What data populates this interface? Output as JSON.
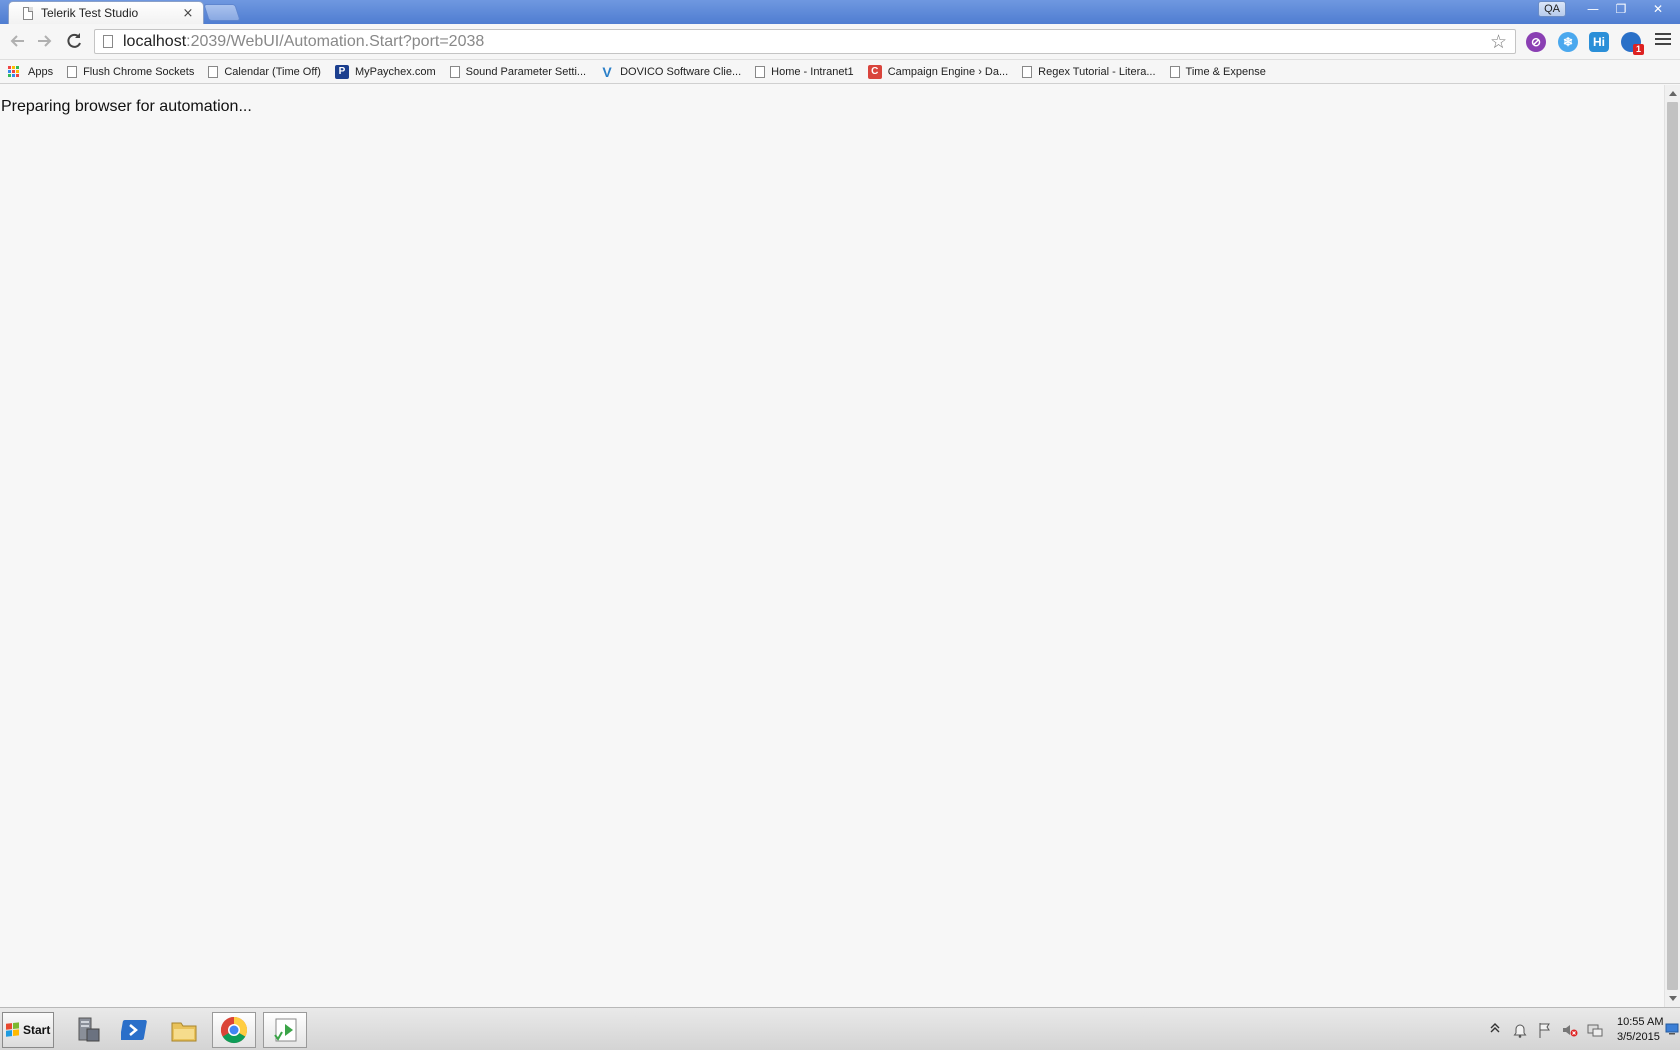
{
  "browser": {
    "tab": {
      "title": "Telerik Test Studio",
      "close_glyph": "×"
    },
    "profile_badge": "QA",
    "window_controls": {
      "minimize": "—",
      "restore": "❐",
      "close": "✕"
    },
    "toolbar": {
      "back_icon": "back-arrow-icon",
      "forward_icon": "forward-arrow-icon",
      "reload_icon": "reload-icon",
      "url_host": "localhost",
      "url_path": ":2039/WebUI/Automation.Start?port=2038",
      "star_glyph": "☆",
      "extensions": [
        {
          "name": "purple-extension-icon",
          "label": "⊘",
          "color": "#8a3fb3"
        },
        {
          "name": "snowflake-extension-icon",
          "label": "❄",
          "color": "#4aa8ee"
        },
        {
          "name": "hi-extension-icon",
          "label": "Hi",
          "color": "#2b8fd8"
        },
        {
          "name": "globe-extension-icon",
          "label": "1",
          "color": "#2a70c8"
        }
      ]
    },
    "bookmarks": [
      {
        "label": "Apps"
      },
      {
        "label": "Flush Chrome Sockets"
      },
      {
        "label": "Calendar (Time Off)"
      },
      {
        "label": "MyPaychex.com"
      },
      {
        "label": "Sound Parameter Setti..."
      },
      {
        "label": "DOVICO Software Clie..."
      },
      {
        "label": "Home - Intranet1"
      },
      {
        "label": "Campaign Engine › Da..."
      },
      {
        "label": "Regex Tutorial - Litera..."
      },
      {
        "label": "Time & Expense"
      }
    ]
  },
  "page": {
    "status_text": "Preparing browser for automation..."
  },
  "taskbar": {
    "start_label": "Start",
    "clock": {
      "time": "10:55 AM",
      "date": "3/5/2015"
    }
  }
}
